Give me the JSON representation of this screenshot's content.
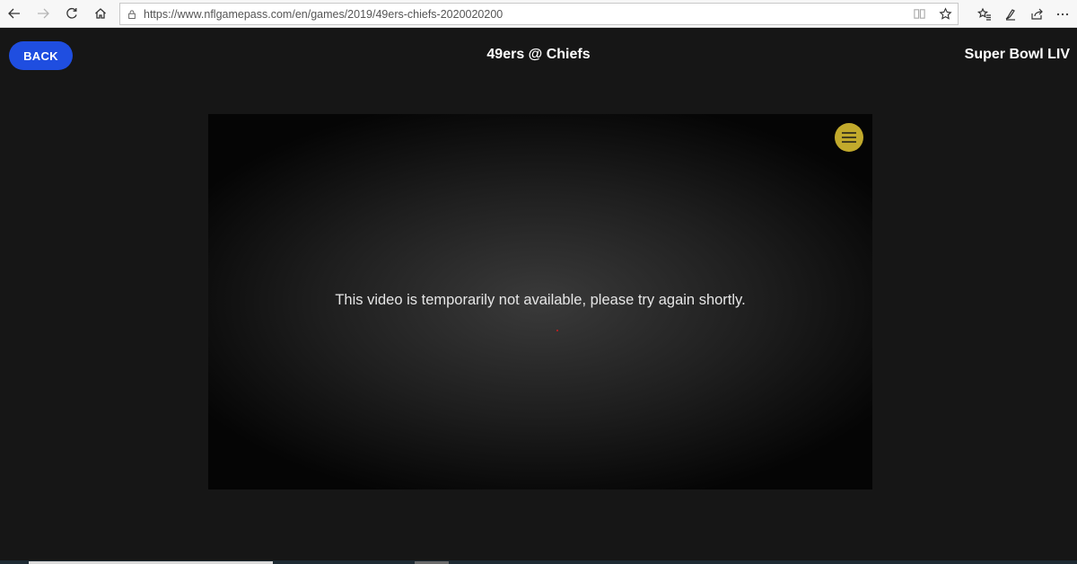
{
  "browser": {
    "url": "https://www.nflgamepass.com/en/games/2019/49ers-chiefs-2020020200"
  },
  "header": {
    "back_label": "BACK",
    "game_title": "49ers @ Chiefs",
    "event_title": "Super Bowl LIV"
  },
  "player": {
    "message": "This video is temporarily not available, please try again shortly."
  },
  "colors": {
    "back_button": "#1f4ee0",
    "menu_button": "#c2aa2c",
    "page_background": "#161616"
  }
}
